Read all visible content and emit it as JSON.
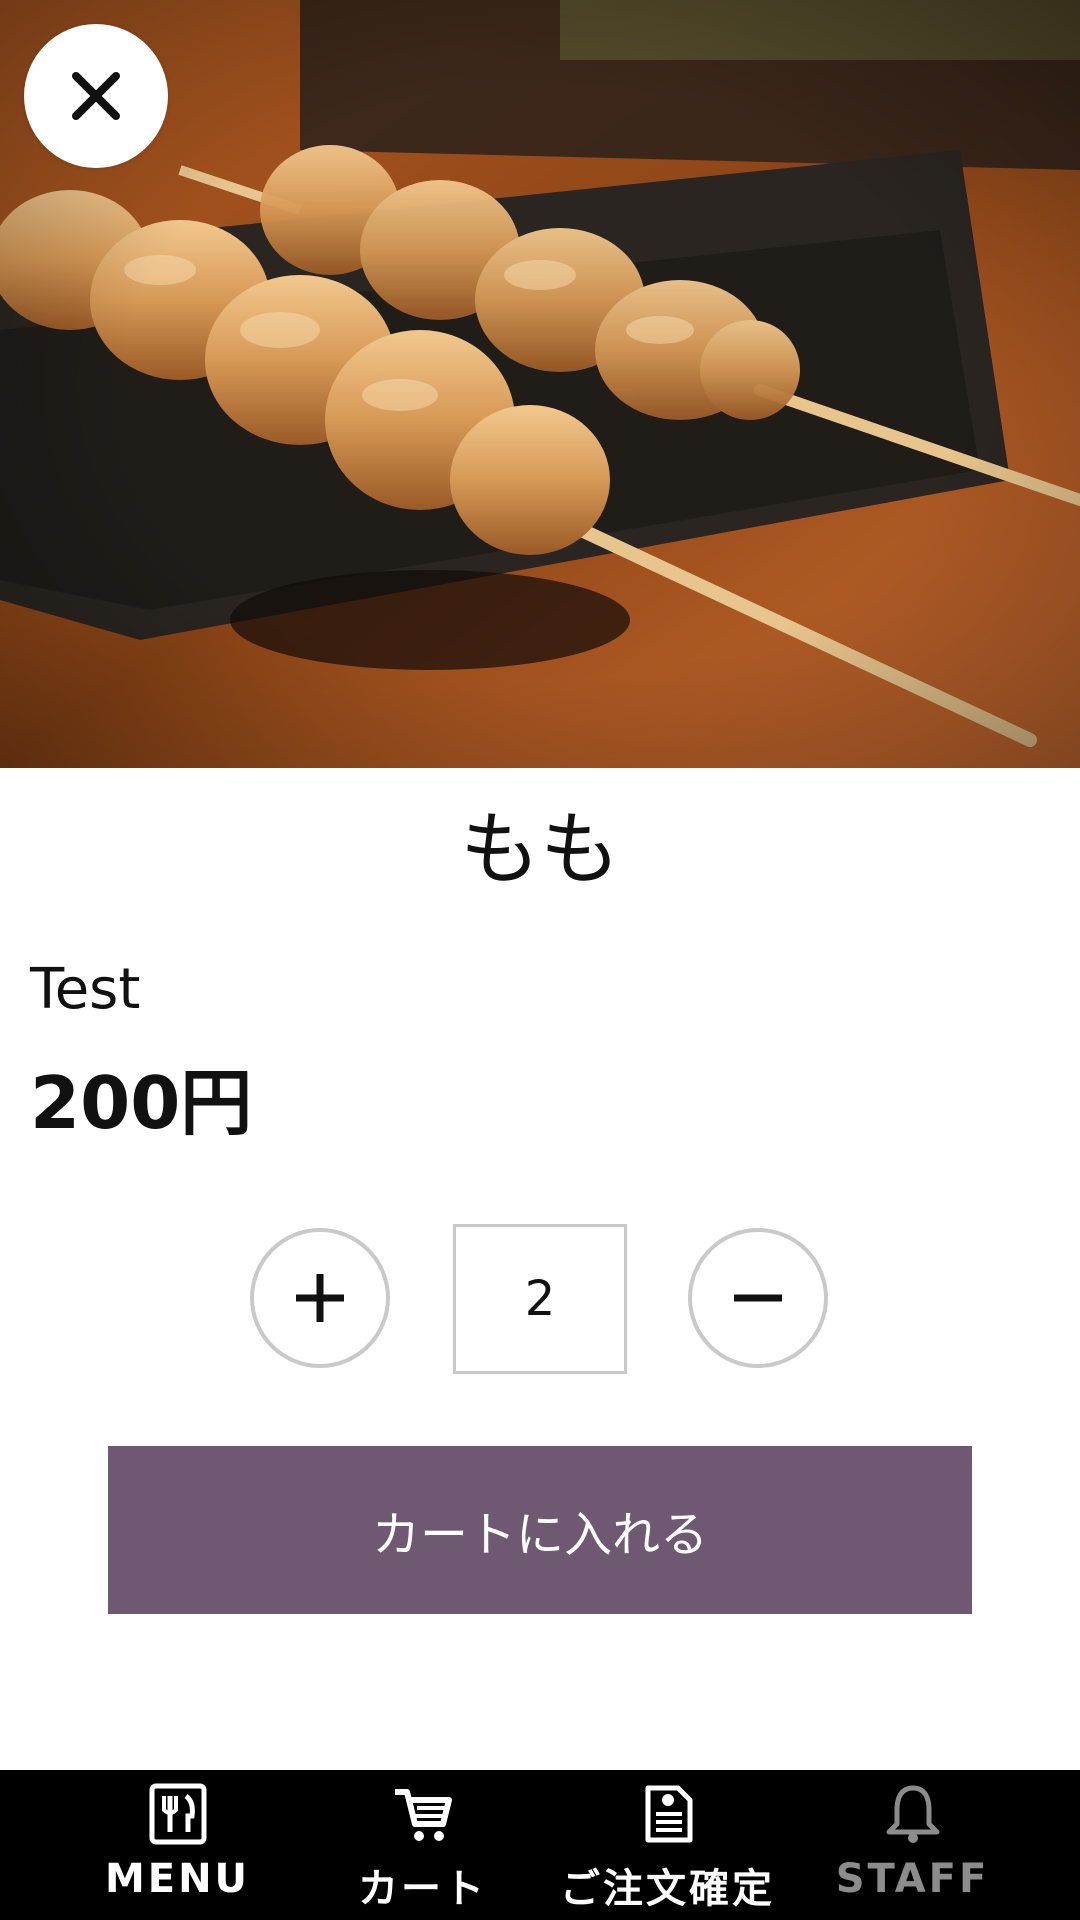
{
  "product": {
    "name": "もも",
    "description": "Test",
    "price": "200円",
    "image_alt": "grilled chicken thigh skewers"
  },
  "quantity": {
    "value": "2"
  },
  "actions": {
    "add_to_cart": "カートに入れる"
  },
  "bottom_nav": {
    "items": [
      {
        "label": "MENU",
        "icon": "menu-icon",
        "enabled": true
      },
      {
        "label": "カート",
        "icon": "cart-icon",
        "enabled": true
      },
      {
        "label": "ご注文確定",
        "icon": "order-confirm-icon",
        "enabled": true
      },
      {
        "label": "STAFF",
        "icon": "bell-icon",
        "enabled": false
      }
    ]
  },
  "colors": {
    "accent": "#6f5872",
    "nav_background": "#000000",
    "border": "#c9c9c9"
  }
}
